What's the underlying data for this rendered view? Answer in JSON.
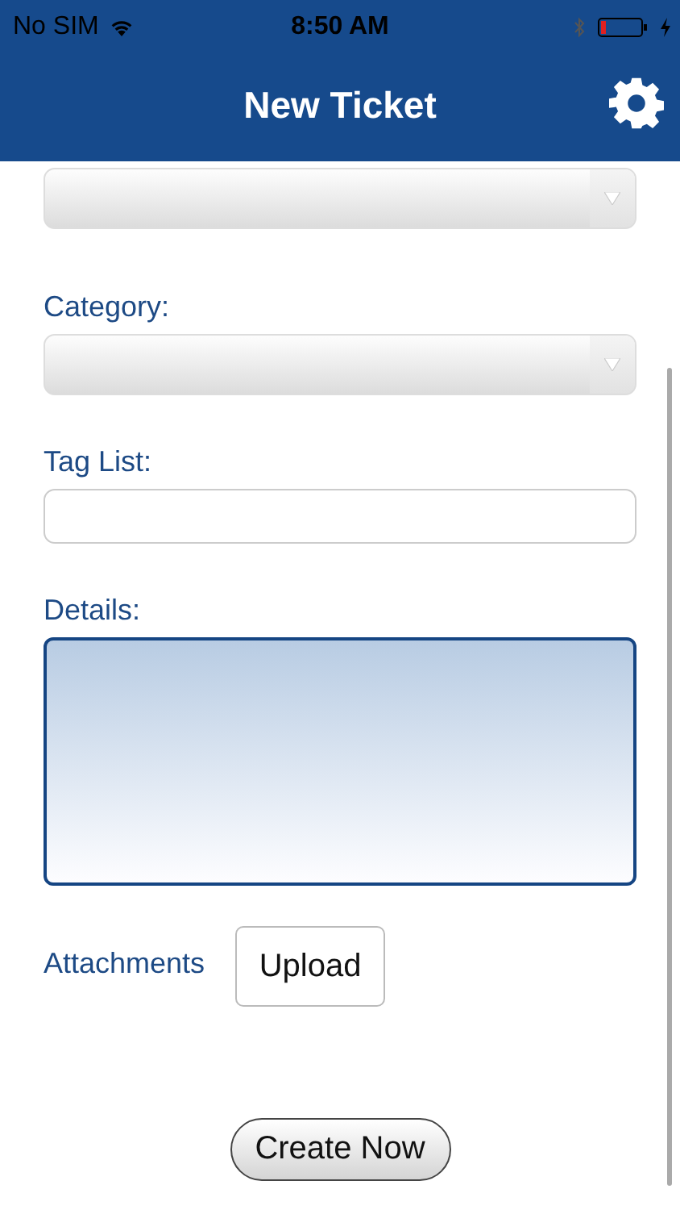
{
  "status_bar": {
    "carrier": "No SIM",
    "time": "8:50 AM"
  },
  "header": {
    "title": "New Ticket"
  },
  "fields": [
    {
      "kind": "select"
    },
    {
      "kind": "select",
      "label": "Category:"
    },
    {
      "kind": "text",
      "label": "Tag List:"
    },
    {
      "kind": "textarea",
      "label": "Details:",
      "focused": true
    }
  ],
  "attachments": {
    "label": "Attachments",
    "button": "Upload"
  },
  "submit": "Create Now"
}
